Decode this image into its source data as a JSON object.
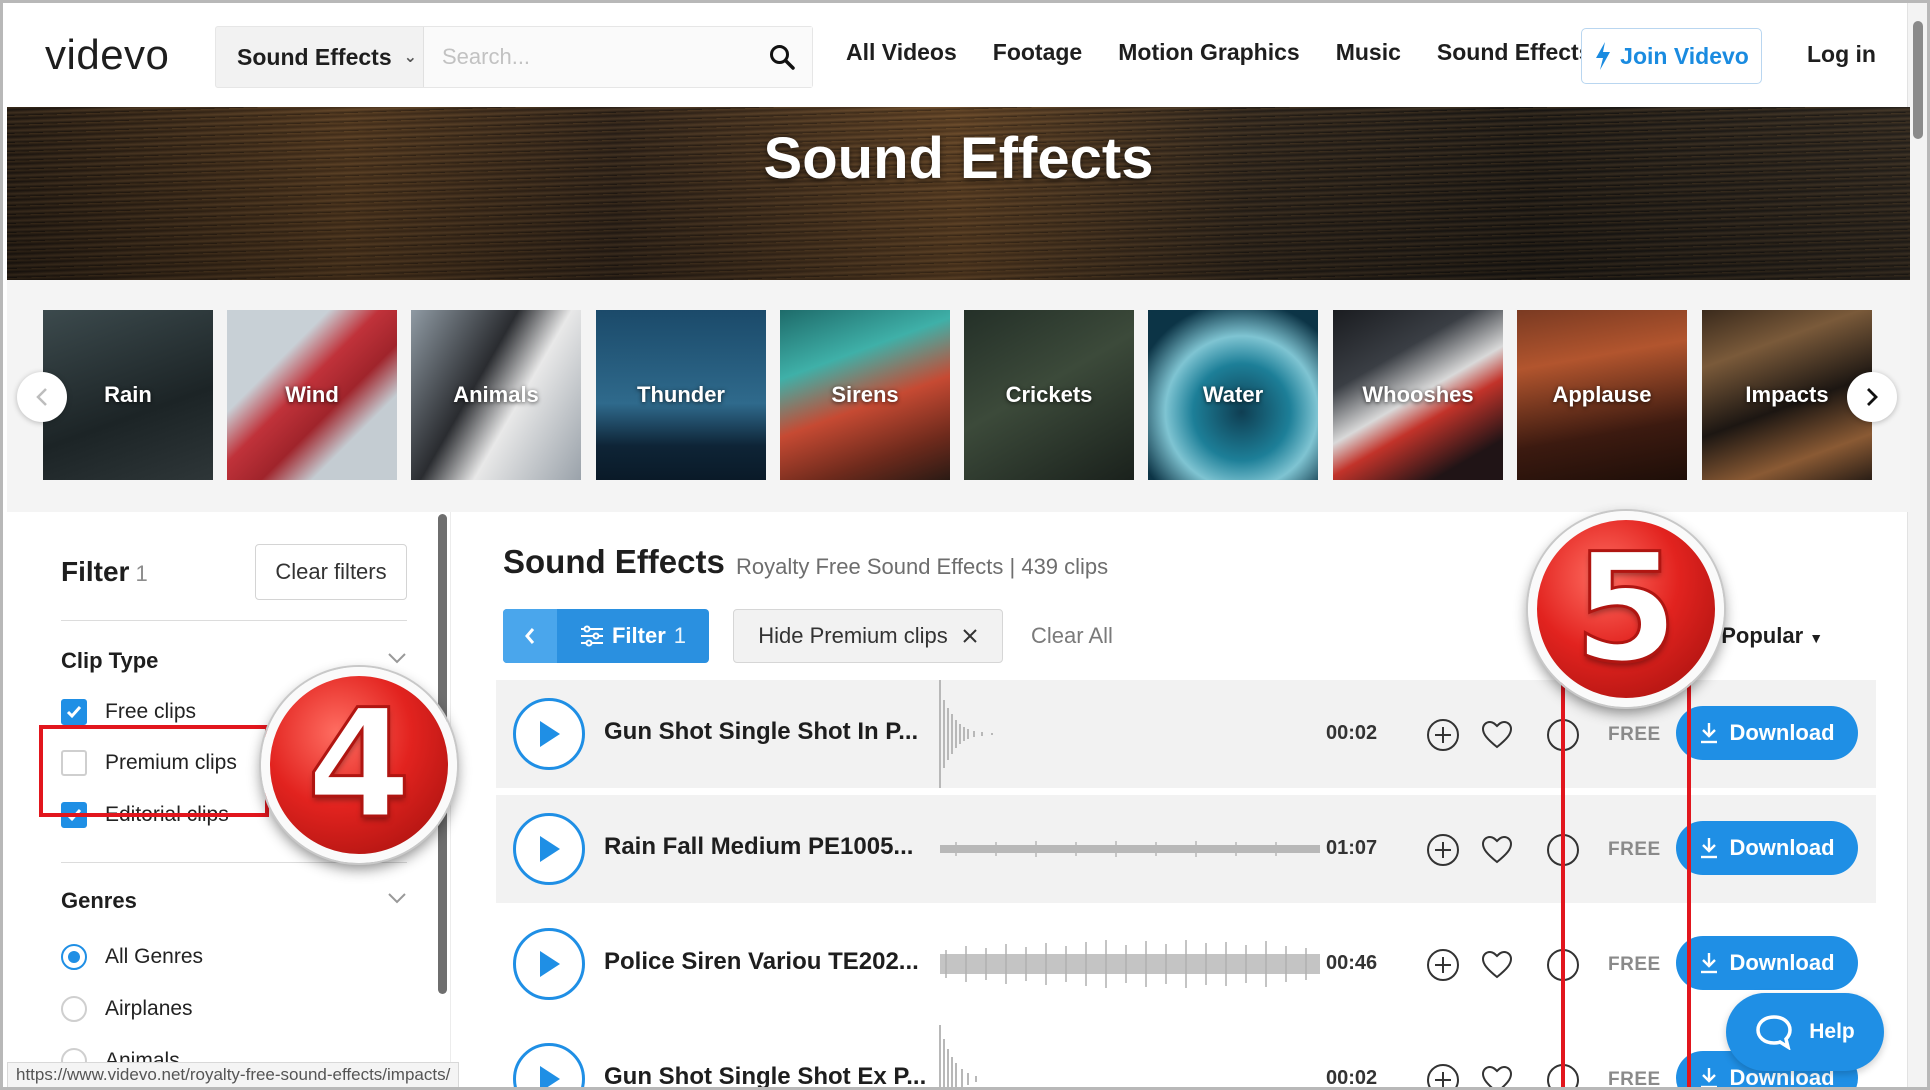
{
  "header": {
    "logo": "videvo",
    "search_category": "Sound Effects",
    "search_placeholder": "Search...",
    "nav": [
      "All Videos",
      "Footage",
      "Motion Graphics",
      "Music",
      "Sound Effects"
    ],
    "join_label": "Join Videvo",
    "login_label": "Log in"
  },
  "hero": {
    "title": "Sound Effects"
  },
  "categories": [
    "Rain",
    "Wind",
    "Animals",
    "Thunder",
    "Sirens",
    "Crickets",
    "Water",
    "Whooshes",
    "Applause",
    "Impacts"
  ],
  "sidebar": {
    "filter_label": "Filter",
    "filter_count": "1",
    "clear_filters": "Clear filters",
    "clip_type_label": "Clip Type",
    "clip_types": [
      {
        "label": "Free clips",
        "checked": true
      },
      {
        "label": "Premium clips",
        "checked": false
      },
      {
        "label": "Editorial clips",
        "checked": true
      }
    ],
    "genres_label": "Genres",
    "genres": [
      {
        "label": "All Genres",
        "selected": true
      },
      {
        "label": "Airplanes",
        "selected": false
      },
      {
        "label": "Animals",
        "selected": false
      }
    ]
  },
  "main": {
    "title": "Sound Effects",
    "subtitle": "Royalty Free Sound Effects | 439 clips",
    "filter_button": "Filter",
    "filter_count": "1",
    "chip_label": "Hide Premium clips",
    "clear_all": "Clear All",
    "sort_prefix": "t",
    "sort_label": "Popular"
  },
  "clips": [
    {
      "title": "Gun Shot Single Shot In P...",
      "duration": "00:02",
      "license": "FREE",
      "download": "Download"
    },
    {
      "title": "Rain Fall Medium PE1005...",
      "duration": "01:07",
      "license": "FREE",
      "download": "Download"
    },
    {
      "title": "Police Siren Variou TE202...",
      "duration": "00:46",
      "license": "FREE",
      "download": "Download"
    },
    {
      "title": "Gun Shot Single Shot Ex P...",
      "duration": "00:02",
      "license": "FREE",
      "download": "Download"
    }
  ],
  "annotations": {
    "step4": "4",
    "step5": "5"
  },
  "status_url": "https://www.videvo.net/royalty-free-sound-effects/impacts/",
  "help_label": "Help",
  "colors": {
    "accent": "#1f8fe5",
    "annotation_red": "#e2161d"
  }
}
